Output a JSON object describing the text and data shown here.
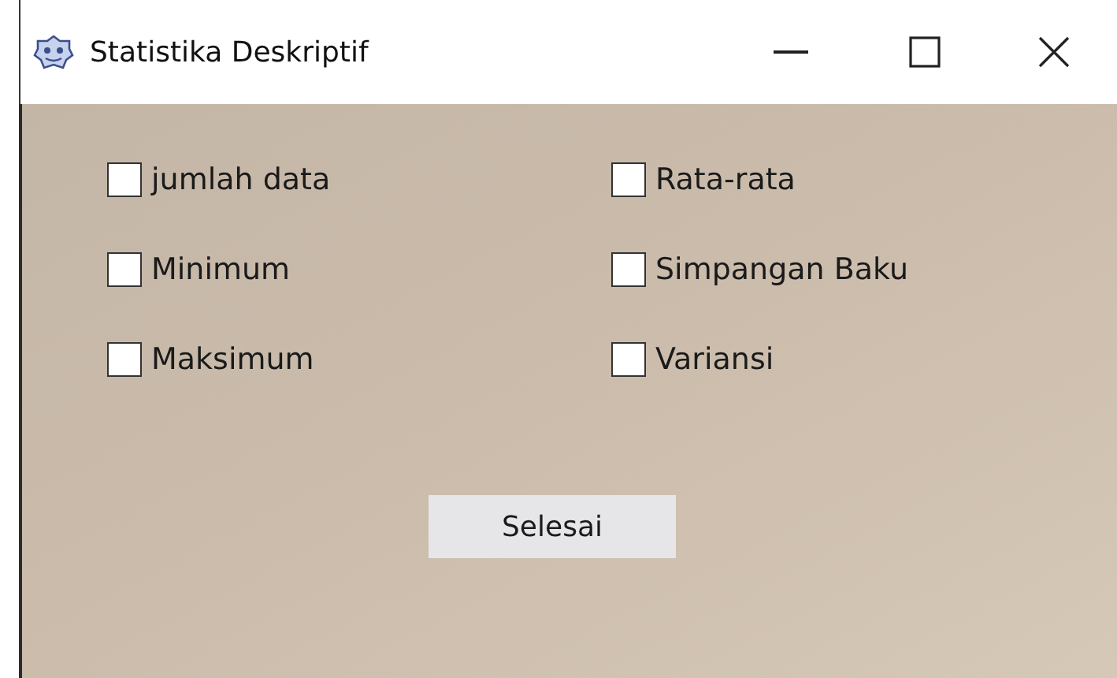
{
  "window": {
    "title": "Statistika Deskriptif"
  },
  "options": [
    {
      "label": "jumlah data",
      "checked": false
    },
    {
      "label": "Rata-rata",
      "checked": false
    },
    {
      "label": "Minimum",
      "checked": false
    },
    {
      "label": "Simpangan Baku",
      "checked": false
    },
    {
      "label": "Maksimum",
      "checked": false
    },
    {
      "label": "Variansi",
      "checked": false
    }
  ],
  "button": "Selesai"
}
